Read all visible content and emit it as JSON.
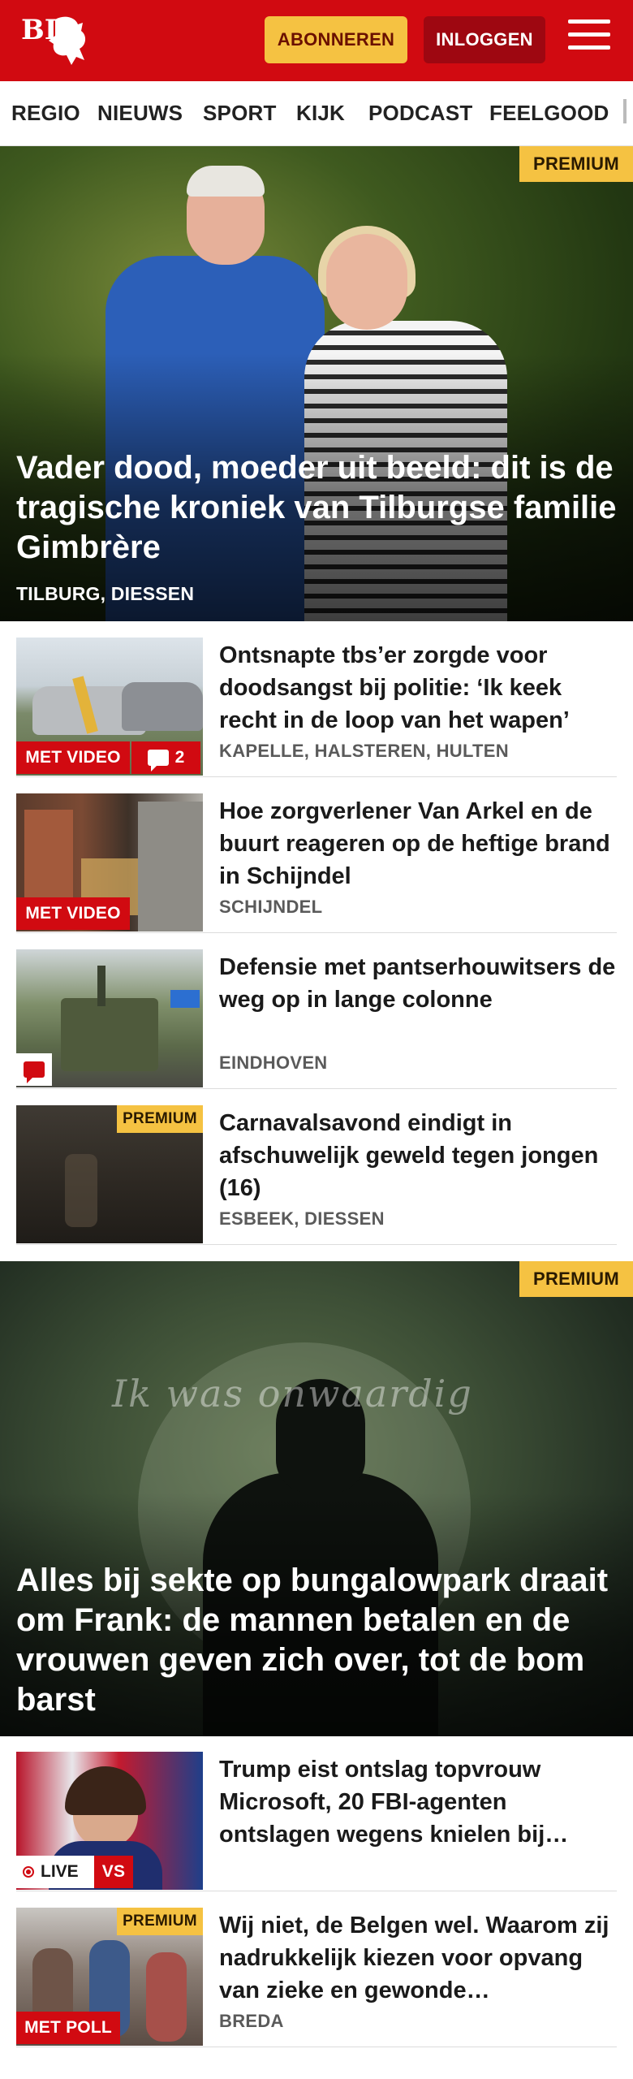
{
  "header": {
    "logo_text": "BD",
    "subscribe_label": "ABONNEREN",
    "login_label": "INLOGGEN",
    "colors": {
      "brand": "#d10a11",
      "subscribe_bg": "#f5c242",
      "login_bg": "#9e0711"
    }
  },
  "nav": {
    "items": [
      "REGIO",
      "NIEUWS",
      "SPORT",
      "KIJK",
      "PODCAST",
      "FEELGOOD"
    ]
  },
  "hero": {
    "badge": "PREMIUM",
    "title": "Vader dood, moeder uit beeld: dit is de tragische kroniek van Tilburgse familie Gimbrère",
    "location": "TILBURG, DIESSEN"
  },
  "articles": [
    {
      "title": "Ontsnapte tbs’er zorgde voor doodsangst bij politie: ‘Ik keek recht in de loop van het wapen’",
      "location": "KAPELLE, HALSTEREN, HULTEN",
      "badge": "MET VIDEO",
      "comments": "2"
    },
    {
      "title": "Hoe zorgverlener Van Arkel en de buurt reageren op de heftige brand in Schijndel",
      "location": "SCHIJNDEL",
      "badge": "MET VIDEO"
    },
    {
      "title": "Defensie met pantserhouwitsers de weg op in lange colonne",
      "location": "EINDHOVEN"
    },
    {
      "title": "Carnavalsavond eindigt in afschuwelijk geweld tegen jongen (16)",
      "location": "ESBEEK, DIESSEN",
      "badge": "PREMIUM"
    }
  ],
  "feature": {
    "badge": "PREMIUM",
    "image_text": "Ik was onwaardig",
    "title": "Alles bij sekte op bungalowpark draait om Frank: de mannen betalen en de vrouwen geven zich over, tot de bom barst"
  },
  "articles2": [
    {
      "title": "Trump eist ontslag topvrouw Microsoft, 20 FBI-agenten ontslagen wegens knielen bij…",
      "live_label": "LIVE",
      "vs_label": "VS"
    },
    {
      "title": "Wij niet, de Belgen wel. Waarom zij nadrukkelijk kiezen voor opvang van zieke en gewonde…",
      "location": "BREDA",
      "badge_top": "PREMIUM",
      "badge_bottom": "MET POLL"
    }
  ]
}
